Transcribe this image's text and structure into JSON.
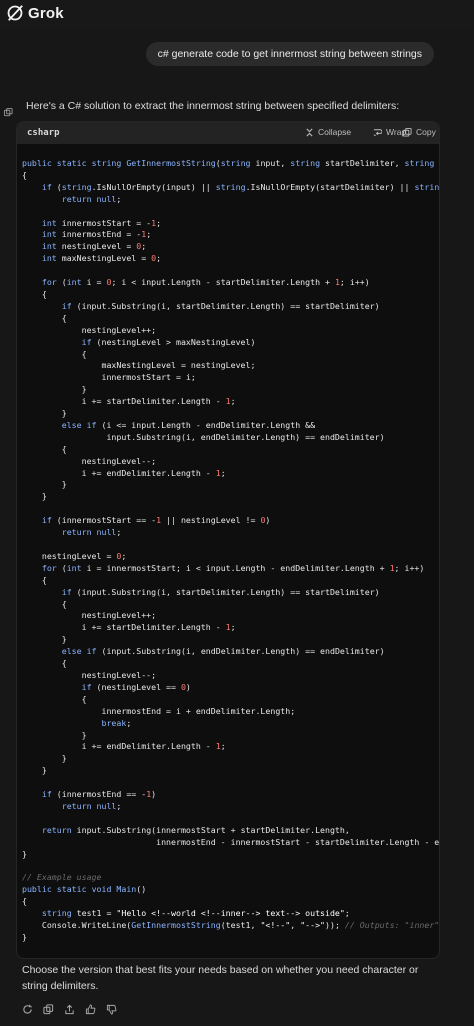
{
  "app": {
    "name": "Grok"
  },
  "user_message": "c# generate code to get innermost string between strings",
  "assistant": {
    "intro": "Here's a C# solution to extract the innermost string between specified delimiters:",
    "code_block": {
      "language": "csharp",
      "collapse_label": "Collapse",
      "wrap_label": "Wrap",
      "copy_label": "Copy",
      "lines": [
        "public static string GetInnermostString(string input, string startDelimiter, string endDe",
        "{",
        "    if (string.IsNullOrEmpty(input) || string.IsNullOrEmpty(startDelimiter) || string.Is",
        "        return null;",
        "",
        "    int innermostStart = -1;",
        "    int innermostEnd = -1;",
        "    int nestingLevel = 0;",
        "    int maxNestingLevel = 0;",
        "",
        "    for (int i = 0; i < input.Length - startDelimiter.Length + 1; i++)",
        "    {",
        "        if (input.Substring(i, startDelimiter.Length) == startDelimiter)",
        "        {",
        "            nestingLevel++;",
        "            if (nestingLevel > maxNestingLevel)",
        "            {",
        "                maxNestingLevel = nestingLevel;",
        "                innermostStart = i;",
        "            }",
        "            i += startDelimiter.Length - 1;",
        "        }",
        "        else if (i <= input.Length - endDelimiter.Length &&",
        "                 input.Substring(i, endDelimiter.Length) == endDelimiter)",
        "        {",
        "            nestingLevel--;",
        "            i += endDelimiter.Length - 1;",
        "        }",
        "    }",
        "",
        "    if (innermostStart == -1 || nestingLevel != 0)",
        "        return null;",
        "",
        "    nestingLevel = 0;",
        "    for (int i = innermostStart; i < input.Length - endDelimiter.Length + 1; i++)",
        "    {",
        "        if (input.Substring(i, startDelimiter.Length) == startDelimiter)",
        "        {",
        "            nestingLevel++;",
        "            i += startDelimiter.Length - 1;",
        "        }",
        "        else if (input.Substring(i, endDelimiter.Length) == endDelimiter)",
        "        {",
        "            nestingLevel--;",
        "            if (nestingLevel == 0)",
        "            {",
        "                innermostEnd = i + endDelimiter.Length;",
        "                break;",
        "            }",
        "            i += endDelimiter.Length - 1;",
        "        }",
        "    }",
        "",
        "    if (innermostEnd == -1)",
        "        return null;",
        "",
        "    return input.Substring(innermostStart + startDelimiter.Length,",
        "                           innermostEnd - innermostStart - startDelimiter.Length - endDel",
        "}",
        "",
        "// Example usage",
        "public static void Main()",
        "{",
        "    string test1 = \"Hello <!--world <!--inner--> text--> outside\";",
        "    Console.WriteLine(GetInnermostString(test1, \"<!--\", \"-->\")); // Outputs: \"inner\"",
        "}"
      ]
    },
    "outro": "Choose the version that best fits your needs based on whether you need character or string delimiters."
  },
  "actions": [
    {
      "icon": "regenerate-icon"
    },
    {
      "icon": "copy-icon"
    },
    {
      "icon": "share-icon"
    },
    {
      "icon": "thumbs-up-icon"
    },
    {
      "icon": "thumbs-down-icon"
    }
  ],
  "colors": {
    "background": "#171717",
    "code_background": "#0e0e0e",
    "keyword": "#8ab4ff",
    "number": "#ff7b72",
    "comment": "#6b6b6b"
  }
}
